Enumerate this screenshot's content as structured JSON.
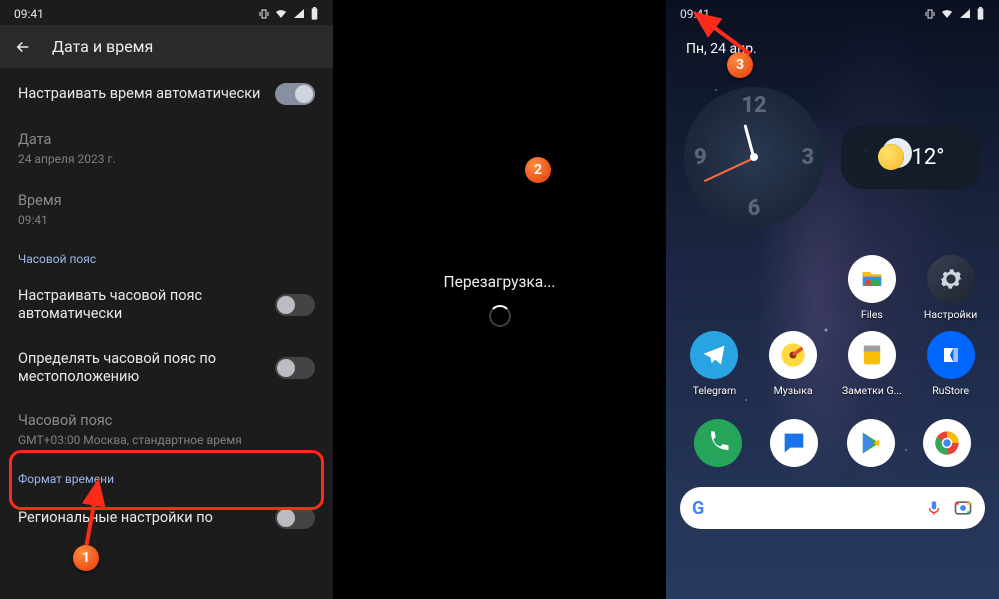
{
  "statusbar": {
    "time": "09:41"
  },
  "panel1": {
    "title": "Дата и время",
    "auto_time": {
      "label": "Настраивать время автоматически",
      "on": true
    },
    "date": {
      "label": "Дата",
      "value": "24 апреля 2023 г."
    },
    "time": {
      "label": "Время",
      "value": "09:41"
    },
    "tz_header": "Часовой пояс",
    "auto_tz": {
      "label": "Настраивать часовой пояс автоматически",
      "on": false
    },
    "tz_location": {
      "label": "Определять часовой пояс по местоположению",
      "on": false
    },
    "timezone": {
      "label": "Часовой пояс",
      "value": "GMT+03:00 Москва, стандартное время"
    },
    "format_header": "Формат времени",
    "regional": {
      "label": "Региональные настройки по"
    }
  },
  "panel2": {
    "text": "Перезагрузка..."
  },
  "panel3": {
    "date": "Пн, 24 апр.",
    "temp": "12°",
    "apps_row1": [
      {
        "name": "files",
        "label": "Files"
      },
      {
        "name": "settings",
        "label": "Настройки"
      }
    ],
    "apps_row2": [
      {
        "name": "telegram",
        "label": "Telegram"
      },
      {
        "name": "music",
        "label": "Музыка"
      },
      {
        "name": "notes",
        "label": "Заметки G..."
      },
      {
        "name": "rustore",
        "label": "RuStore"
      }
    ],
    "dock": [
      {
        "name": "phone"
      },
      {
        "name": "messages"
      },
      {
        "name": "play"
      },
      {
        "name": "chrome"
      }
    ]
  },
  "markers": {
    "m1": "1",
    "m2": "2",
    "m3": "3"
  }
}
